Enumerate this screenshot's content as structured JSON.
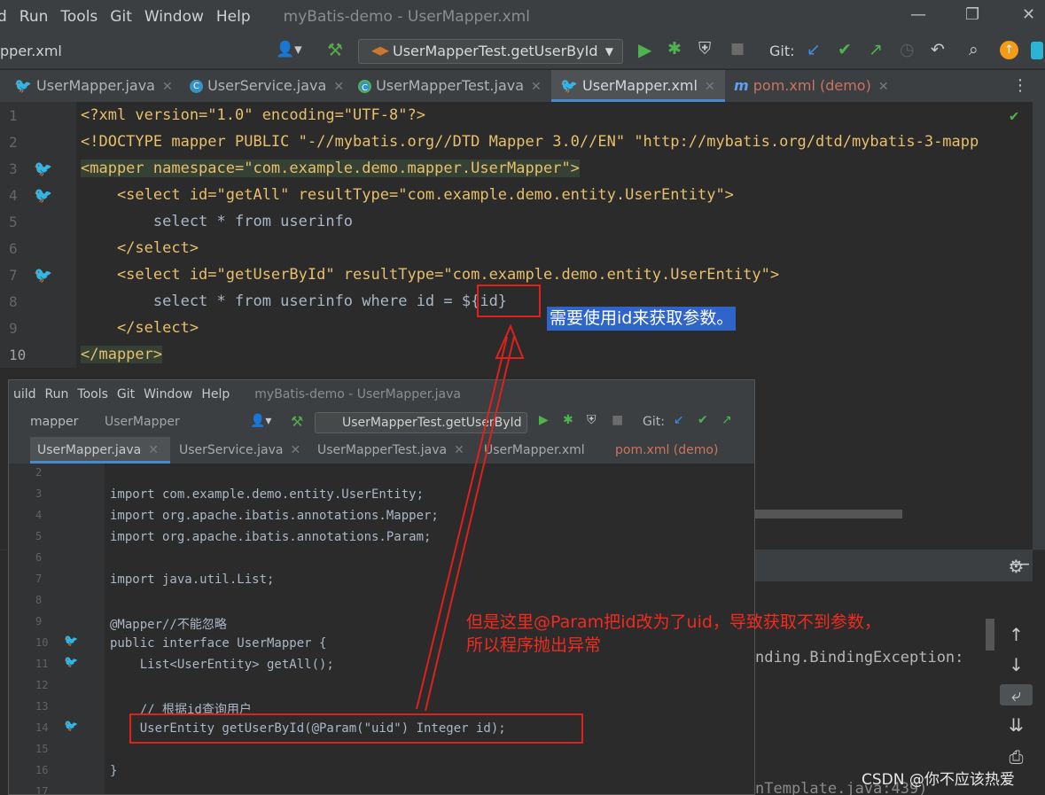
{
  "menubar": {
    "items": [
      "d",
      "Run",
      "Tools",
      "Git",
      "Window",
      "Help"
    ],
    "title": "myBatis-demo - UserMapper.xml",
    "window_buttons": [
      "—",
      "❐",
      "✕"
    ]
  },
  "toolbar": {
    "breadcrumb": "pper.xml",
    "run_config": "UserMapperTest.getUserById",
    "git_label": "Git:"
  },
  "tabs": [
    {
      "label": "UserMapper.java",
      "icon": "mapper-icon",
      "active": false
    },
    {
      "label": "UserService.java",
      "icon": "class-icon",
      "active": false
    },
    {
      "label": "UserMapperTest.java",
      "icon": "test-class-icon",
      "active": false
    },
    {
      "label": "UserMapper.xml",
      "icon": "mybatis-icon",
      "active": true
    },
    {
      "label": "pom.xml (demo)",
      "icon": "maven-icon",
      "active": false
    }
  ],
  "editor": {
    "line_numbers": [
      "1",
      "2",
      "3",
      "4",
      "5",
      "6",
      "7",
      "8",
      "9",
      "10"
    ],
    "lines": [
      "<?xml version=\"1.0\" encoding=\"UTF-8\"?>",
      "<!DOCTYPE mapper PUBLIC \"-//mybatis.org//DTD Mapper 3.0//EN\" \"http://mybatis.org/dtd/mybatis-3-mapp",
      "<mapper namespace=\"com.example.demo.mapper.UserMapper\">",
      "    <select id=\"getAll\" resultType=\"com.example.demo.entity.UserEntity\">",
      "        select * from userinfo",
      "    </select>",
      "    <select id=\"getUserById\" resultType=\"com.example.demo.entity.UserEntity\">",
      "        select * from userinfo where id = ${id}",
      "    </select>",
      "</mapper>"
    ],
    "highlight": "${id}"
  },
  "annotation_blue": "需要使用id来获取参数。",
  "annotation_red": "但是这里@Param把id改为了uid，导致获取不到参数，\n所以程序抛出异常",
  "background_text": {
    "exception": "nding.BindingException:",
    "template": "nTemplate.java:439)"
  },
  "overlay": {
    "menu": [
      "uild",
      "Run",
      "Tools",
      "Git",
      "Window",
      "Help"
    ],
    "title": "myBatis-demo - UserMapper.java",
    "breadcrumb": [
      "mapper",
      "UserMapper"
    ],
    "run_config": "UserMapperTest.getUserById",
    "git_label": "Git:",
    "tabs": [
      {
        "label": "UserMapper.java",
        "active": true
      },
      {
        "label": "UserService.java",
        "active": false
      },
      {
        "label": "UserMapperTest.java",
        "active": false
      },
      {
        "label": "UserMapper.xml",
        "active": false
      },
      {
        "label": "pom.xml (demo)",
        "active": false
      }
    ],
    "line_numbers": [
      "2",
      "3",
      "4",
      "5",
      "6",
      "7",
      "8",
      "9",
      "10",
      "11",
      "12",
      "13",
      "14",
      "15",
      "16",
      "17"
    ],
    "lines": [
      "",
      "import com.example.demo.entity.UserEntity;",
      "import org.apache.ibatis.annotations.Mapper;",
      "import org.apache.ibatis.annotations.Param;",
      "",
      "import java.util.List;",
      "",
      "@Mapper//不能忽略",
      "public interface UserMapper {",
      "    List<UserEntity> getAll();",
      "",
      "    // 根据id查询用户",
      "    UserEntity getUserById(@Param(\"uid\") Integer id);",
      "",
      "}",
      ""
    ]
  },
  "watermark": "CSDN @你不应该热爱",
  "colors": {
    "accent_blue": "#2f65ca",
    "annotation_red": "#e0201a",
    "tag": "#e8bf6a",
    "string": "#6a8759",
    "keyword": "#cc7832"
  }
}
